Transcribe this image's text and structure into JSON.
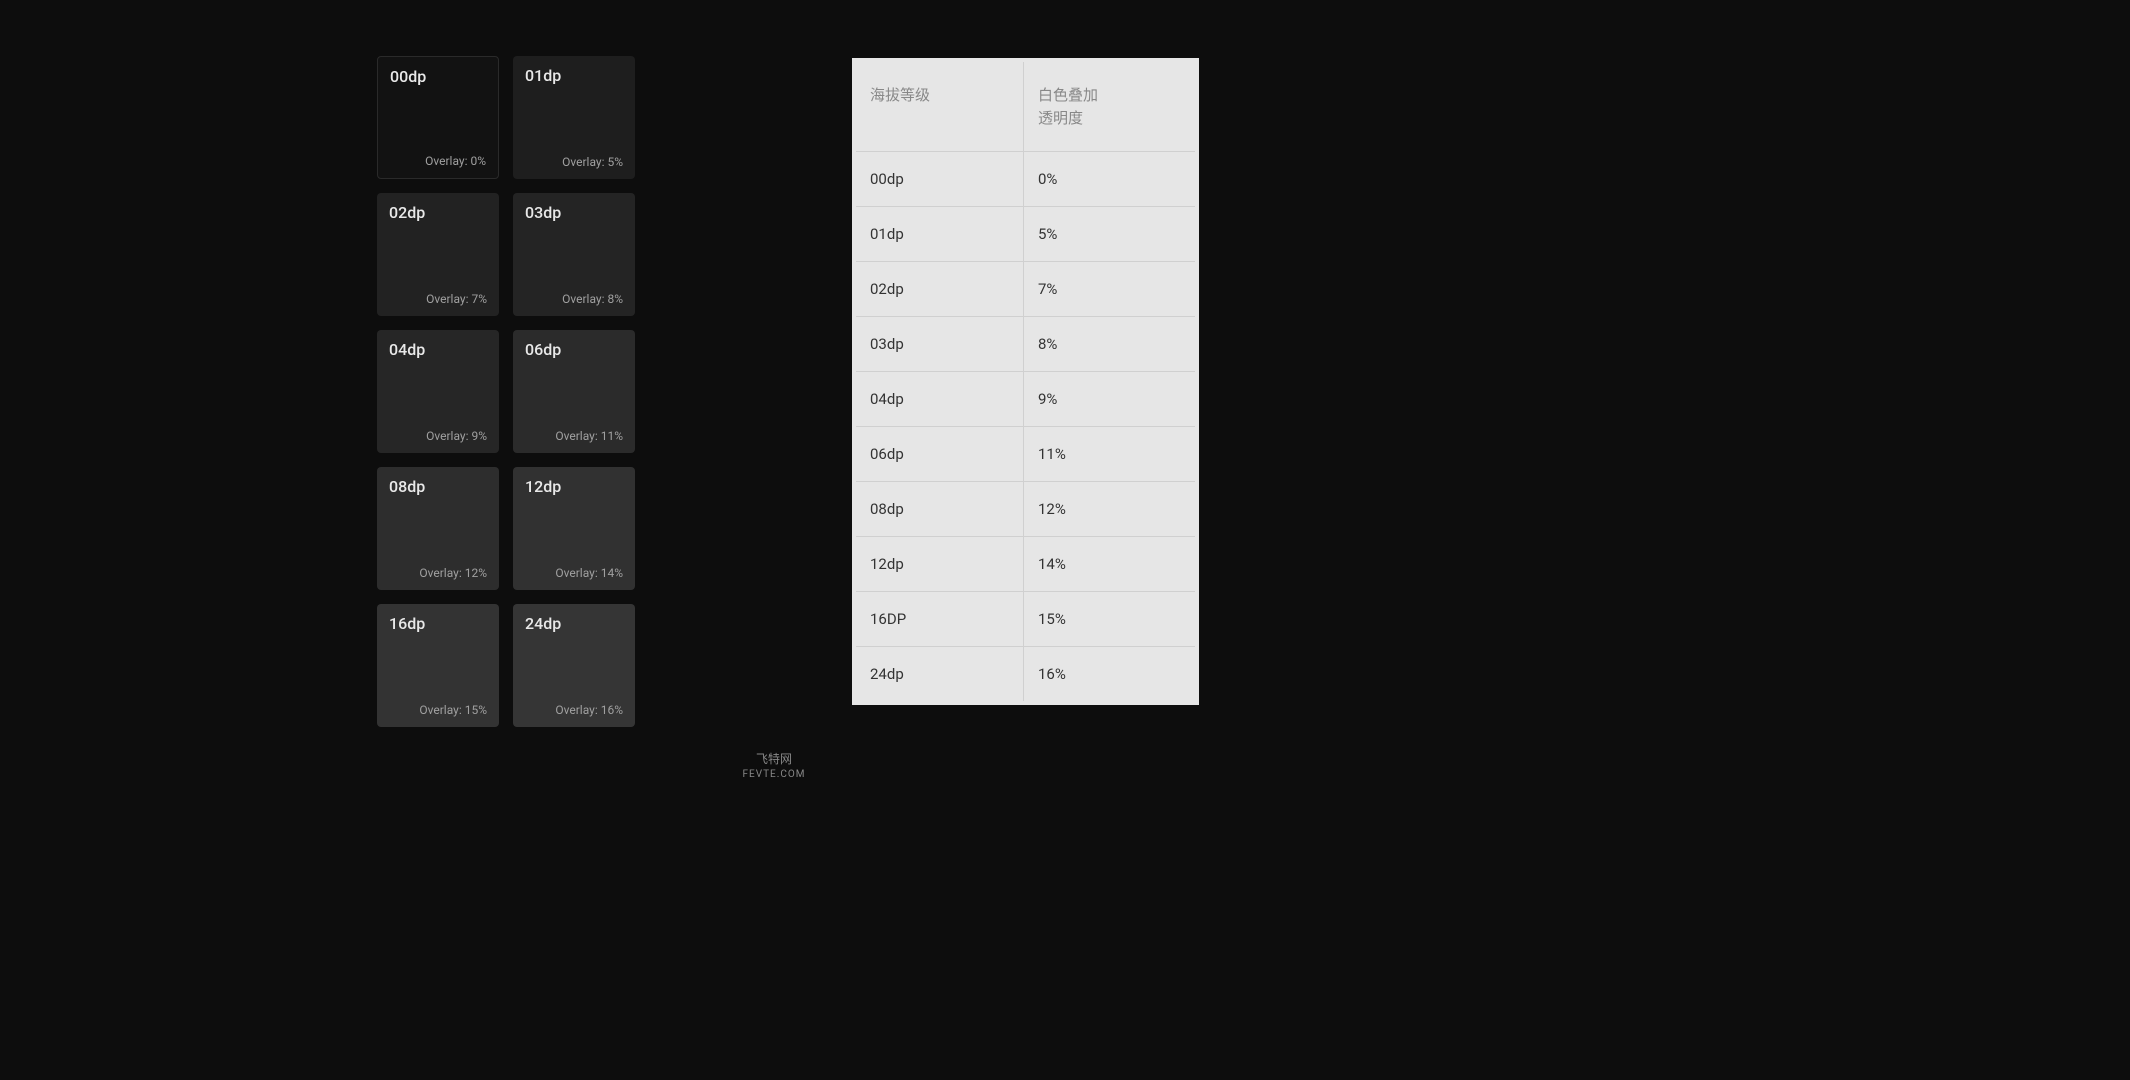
{
  "cards": [
    {
      "title": "00dp",
      "overlay": "Overlay: 0%"
    },
    {
      "title": "01dp",
      "overlay": "Overlay: 5%"
    },
    {
      "title": "02dp",
      "overlay": "Overlay: 7%"
    },
    {
      "title": "03dp",
      "overlay": "Overlay: 8%"
    },
    {
      "title": "04dp",
      "overlay": "Overlay: 9%"
    },
    {
      "title": "06dp",
      "overlay": "Overlay: 11%"
    },
    {
      "title": "08dp",
      "overlay": "Overlay: 12%"
    },
    {
      "title": "12dp",
      "overlay": "Overlay: 14%"
    },
    {
      "title": "16dp",
      "overlay": "Overlay: 15%"
    },
    {
      "title": "24dp",
      "overlay": "Overlay: 16%"
    }
  ],
  "table": {
    "header_left": "海拔等级",
    "header_right": "白色叠加\n透明度",
    "rows": [
      {
        "level": "00dp",
        "opacity": "0%"
      },
      {
        "level": "01dp",
        "opacity": "5%"
      },
      {
        "level": "02dp",
        "opacity": "7%"
      },
      {
        "level": "03dp",
        "opacity": "8%"
      },
      {
        "level": "04dp",
        "opacity": "9%"
      },
      {
        "level": "06dp",
        "opacity": "11%"
      },
      {
        "level": "08dp",
        "opacity": "12%"
      },
      {
        "level": "12dp",
        "opacity": "14%"
      },
      {
        "level": "16DP",
        "opacity": "15%"
      },
      {
        "level": "24dp",
        "opacity": "16%"
      }
    ]
  },
  "footer": {
    "line1": "飞特网",
    "line2": "FEVTE.COM"
  },
  "chart_data": {
    "type": "table",
    "title": "Elevation Level vs White Overlay Opacity",
    "columns": [
      "海拔等级",
      "白色叠加透明度"
    ],
    "rows": [
      [
        "00dp",
        "0%"
      ],
      [
        "01dp",
        "5%"
      ],
      [
        "02dp",
        "7%"
      ],
      [
        "03dp",
        "8%"
      ],
      [
        "04dp",
        "9%"
      ],
      [
        "06dp",
        "11%"
      ],
      [
        "08dp",
        "12%"
      ],
      [
        "12dp",
        "14%"
      ],
      [
        "16DP",
        "15%"
      ],
      [
        "24dp",
        "16%"
      ]
    ]
  }
}
